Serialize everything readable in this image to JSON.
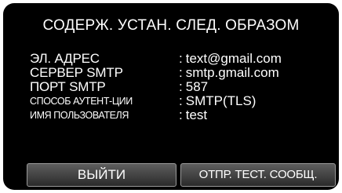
{
  "dialog": {
    "title": "СОДЕРЖ. УСТАН. СЛЕД. ОБРАЗОМ",
    "separator": ":",
    "rows": [
      {
        "label": "ЭЛ. АДРЕС",
        "value": "text@gmail.com"
      },
      {
        "label": "СЕРВЕР SMTP",
        "value": "smtp.gmail.com"
      },
      {
        "label": "ПОРТ SMTP",
        "value": "587"
      },
      {
        "label": "СПОСОБ АУТЕНТ-ЦИИ",
        "value": "SMTP(TLS)"
      },
      {
        "label": "ИМЯ ПОЛЬЗОВАТЕЛЯ",
        "value": "test"
      }
    ]
  },
  "buttons": {
    "exit_label": "ВЫЙТИ",
    "send_test_label": "ОТПР. ТЕСТ. СООБЩ."
  }
}
